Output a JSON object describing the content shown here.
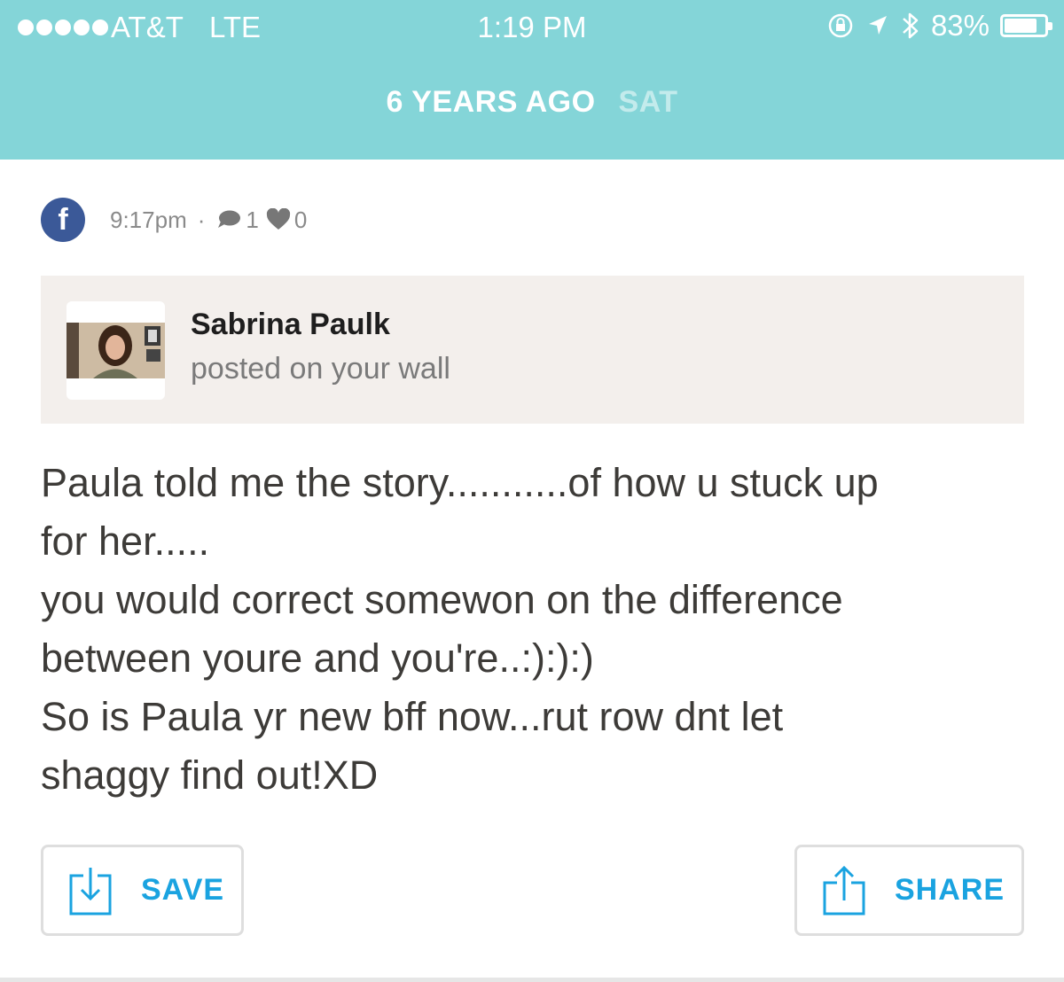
{
  "status_bar": {
    "signal_dots": 5,
    "carrier": "AT&T",
    "network": "LTE",
    "time": "1:19 PM",
    "battery_percent": "83%",
    "battery_level": 0.83
  },
  "header": {
    "date_label": "6 YEARS AGO",
    "day_label": "SAT",
    "background_color": "#84d5d8"
  },
  "post": {
    "source_icon": "facebook-icon",
    "time": "9:17pm",
    "separator": "·",
    "comments": "1",
    "likes": "0",
    "author": "Sabrina Paulk",
    "action": "posted on your wall",
    "lines": [
      "Paula told me the story...........of how u stuck up",
      "for her.....",
      "you would correct somewon on the difference",
      "between youre and you're..:):):)",
      "So is Paula yr new bff now...rut row dnt let",
      "shaggy find out!XD"
    ]
  },
  "buttons": {
    "save_label": "SAVE",
    "share_label": "SHARE",
    "accent_color": "#1aa3e0"
  }
}
